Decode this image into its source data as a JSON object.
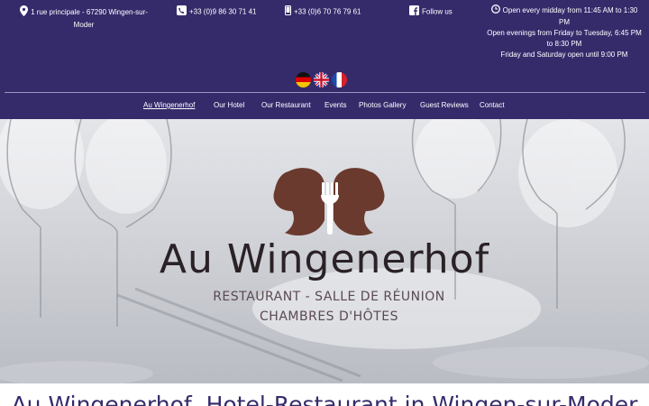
{
  "contact": {
    "address": "1 rue principale - 67290 Wingen-sur-Moder",
    "phone_1": "+33 (0)9 86 30 71 41",
    "phone_2": "+33 (0)6 70 76 79 61",
    "follow_label": "Follow us",
    "hours_line_1": "Open every midday from 11:45 AM to 1:30 PM",
    "hours_line_2": "Open evenings from Friday to Tuesday, 6:45 PM to 8:30 PM",
    "hours_line_3": "Friday and Saturday open until 9:00 PM"
  },
  "languages": [
    "German",
    "English",
    "French"
  ],
  "nav": {
    "items": [
      {
        "label": "Au Wingenerhof",
        "active": true
      },
      {
        "label": "Our Hotel"
      },
      {
        "label": "Our Restaurant"
      },
      {
        "label": "Events"
      },
      {
        "label": "Photos Gallery"
      },
      {
        "label": "Guest Reviews"
      },
      {
        "label": "Contact"
      }
    ]
  },
  "hero": {
    "logo_name": "Au Wingenerhof",
    "tagline_1": "RESTAURANT - SALLE DE RÉUNION",
    "tagline_2": "CHAMBRES D'HÔTES"
  },
  "page": {
    "title": "Au Wingenerhof, Hotel-Restaurant in Wingen-sur-Moder"
  },
  "colors": {
    "header_bg": "#352b6b",
    "logo_brown": "#6a3a2e",
    "logo_text": "#2a2226",
    "tagline": "#5b4a52"
  },
  "icons": [
    "map-marker-icon",
    "phone-icon",
    "mobile-icon",
    "facebook-icon",
    "clock-icon",
    "fork-icon"
  ]
}
